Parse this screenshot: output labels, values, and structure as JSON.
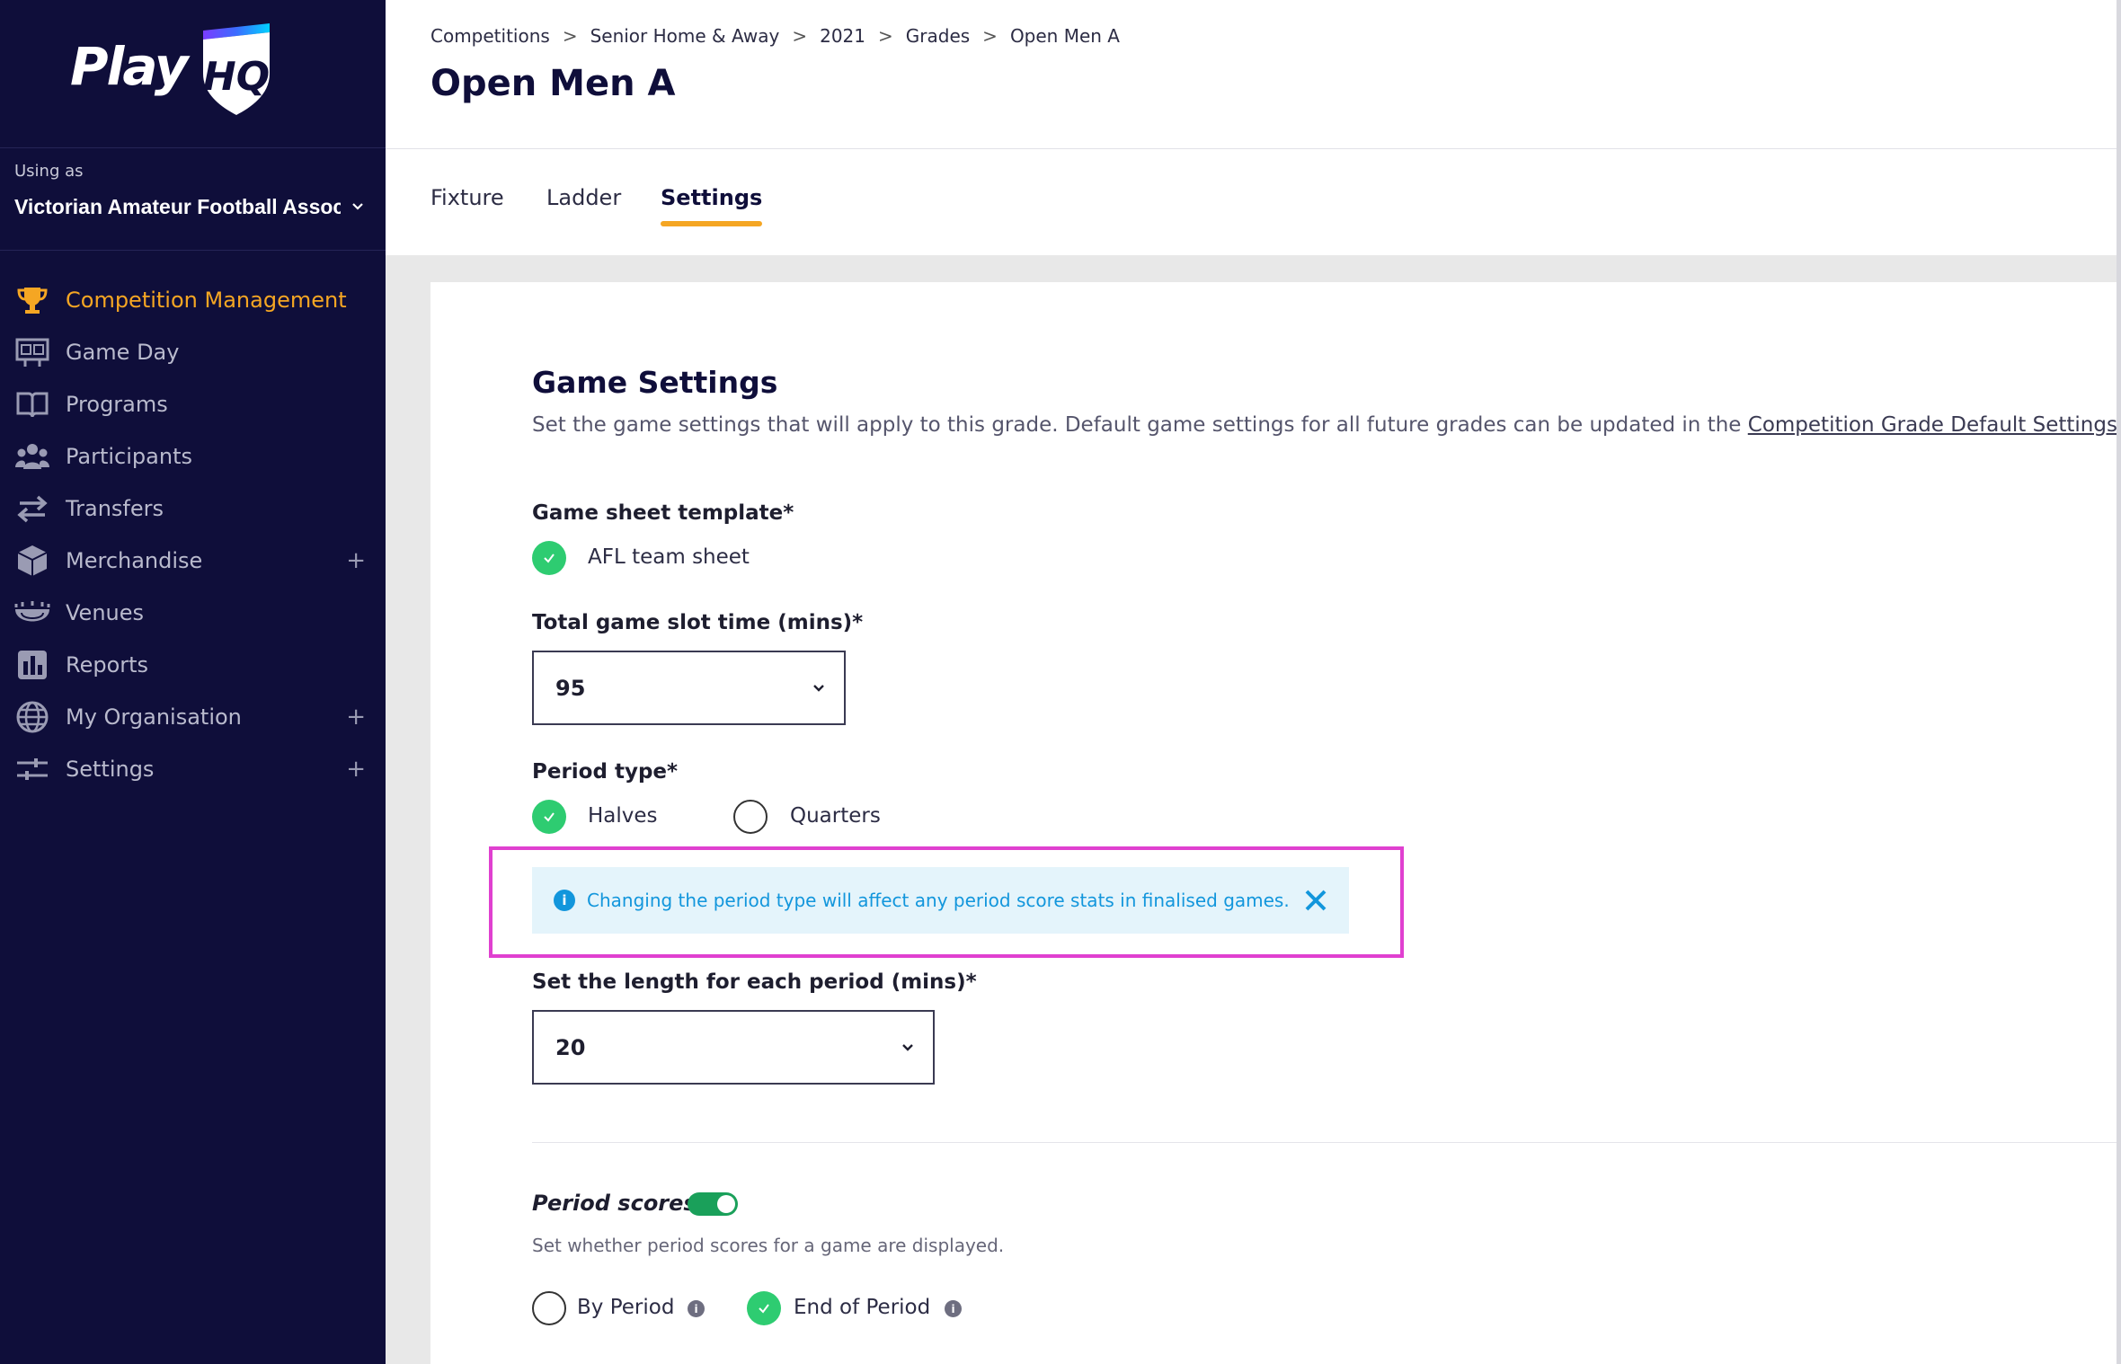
{
  "sidebar": {
    "logo": "PlayHQ",
    "using_as_label": "Using as",
    "organisation": "Victorian Amateur Football Association",
    "nav": [
      {
        "label": "Competition Management",
        "icon": "trophy-icon",
        "active": true
      },
      {
        "label": "Game Day",
        "icon": "scoreboard-icon"
      },
      {
        "label": "Programs",
        "icon": "book-icon"
      },
      {
        "label": "Participants",
        "icon": "people-icon"
      },
      {
        "label": "Transfers",
        "icon": "transfer-arrows-icon"
      },
      {
        "label": "Merchandise",
        "icon": "box-icon",
        "expandable": true
      },
      {
        "label": "Venues",
        "icon": "stadium-icon"
      },
      {
        "label": "Reports",
        "icon": "reports-icon"
      },
      {
        "label": "My Organisation",
        "icon": "globe-icon",
        "expandable": true
      },
      {
        "label": "Settings",
        "icon": "sliders-icon",
        "expandable": true
      }
    ],
    "plus_symbol": "+"
  },
  "header": {
    "breadcrumb": [
      "Competitions",
      "Senior Home & Away",
      "2021",
      "Grades",
      "Open Men A"
    ],
    "separator": ">",
    "title": "Open Men A"
  },
  "tabs": [
    {
      "label": "Fixture"
    },
    {
      "label": "Ladder"
    },
    {
      "label": "Settings",
      "active": true
    }
  ],
  "game_settings": {
    "title": "Game Settings",
    "description": "Set the game settings that will apply to this grade. Default game settings for all future grades can be updated in the ",
    "description_link": "Competition Grade Default Settings",
    "sheet_template_label": "Game sheet template*",
    "sheet_template_value": "AFL team sheet",
    "slot_time_label": "Total game slot time (mins)*",
    "slot_time_value": "95",
    "period_type_label": "Period type*",
    "period_options": [
      {
        "label": "Halves",
        "selected": true
      },
      {
        "label": "Quarters",
        "selected": false
      }
    ],
    "info_banner": "Changing the period type will affect any period score stats in finalised games.",
    "period_length_label": "Set the length for each period (mins)*",
    "period_length_value": "20",
    "period_scores_label": "Period scores",
    "period_scores_enabled": true,
    "period_scores_desc": "Set whether period scores for a game are displayed.",
    "period_score_options": [
      {
        "label": "By Period",
        "selected": false
      },
      {
        "label": "End of Period",
        "selected": true
      }
    ]
  },
  "colors": {
    "sidebar_bg": "#0f0e3a",
    "accent": "#f5a623",
    "check_green": "#2ecc71",
    "info_blue": "#1296dc",
    "highlight_magenta": "#e040d0"
  }
}
